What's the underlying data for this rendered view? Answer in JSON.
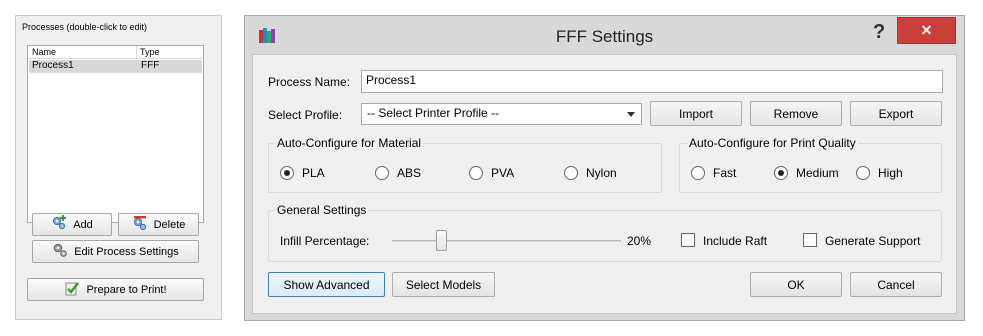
{
  "processes_panel": {
    "title": "Processes (double-click to edit)",
    "columns": [
      "Name",
      "Type"
    ],
    "rows": [
      {
        "name": "Process1",
        "type": "FFF"
      }
    ],
    "add_label": "Add",
    "delete_label": "Delete",
    "edit_label": "Edit Process Settings",
    "print_label": "Prepare to Print!"
  },
  "dialog": {
    "title": "FFF Settings",
    "help_glyph": "?",
    "close_glyph": "✕",
    "process_name_label": "Process Name:",
    "process_name_value": "Process1",
    "select_profile_label": "Select Profile:",
    "select_profile_value": "-- Select Printer Profile --",
    "import_label": "Import",
    "remove_label": "Remove",
    "export_label": "Export",
    "material_group": {
      "title": "Auto-Configure for Material",
      "options": [
        "PLA",
        "ABS",
        "PVA",
        "Nylon"
      ],
      "selected": "PLA"
    },
    "quality_group": {
      "title": "Auto-Configure for Print Quality",
      "options": [
        "Fast",
        "Medium",
        "High"
      ],
      "selected": "Medium"
    },
    "general_group": {
      "title": "General Settings",
      "infill_label": "Infill Percentage:",
      "infill_value": "20%",
      "infill_fraction": 0.2,
      "include_raft_label": "Include Raft",
      "include_raft_checked": false,
      "generate_support_label": "Generate Support",
      "generate_support_checked": false
    },
    "show_advanced_label": "Show Advanced",
    "select_models_label": "Select Models",
    "ok_label": "OK",
    "cancel_label": "Cancel"
  },
  "icons": {
    "add": "plus-gears-icon",
    "delete": "minus-gears-icon",
    "edit": "gears-icon",
    "print": "checkmark-clipboard-icon",
    "app": "simplify-app-icon"
  },
  "colors": {
    "close_button": "#c9403b",
    "selected_row": "#d9d9d9",
    "focus_border": "#3c7fb1"
  }
}
